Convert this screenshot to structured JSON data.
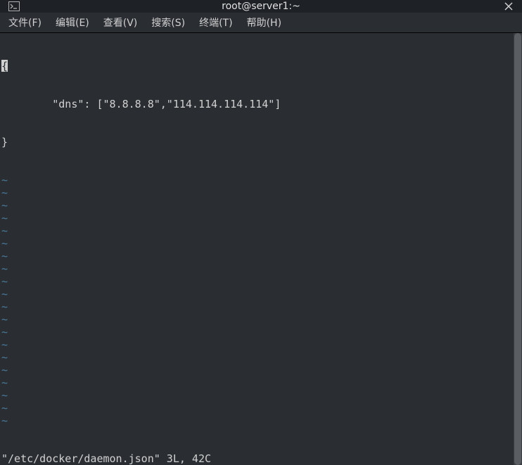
{
  "titlebar": {
    "title": "root@server1:~"
  },
  "menubar": {
    "items": [
      {
        "label": "文件(F)"
      },
      {
        "label": "编辑(E)"
      },
      {
        "label": "查看(V)"
      },
      {
        "label": "搜索(S)"
      },
      {
        "label": "终端(T)"
      },
      {
        "label": "帮助(H)"
      }
    ]
  },
  "editor": {
    "lines": [
      "{",
      "        \"dns\": [\"8.8.8.8\",\"114.114.114.114\"]",
      "}"
    ],
    "tilde": "~",
    "status": "\"/etc/docker/daemon.json\" 3L, 42C"
  }
}
